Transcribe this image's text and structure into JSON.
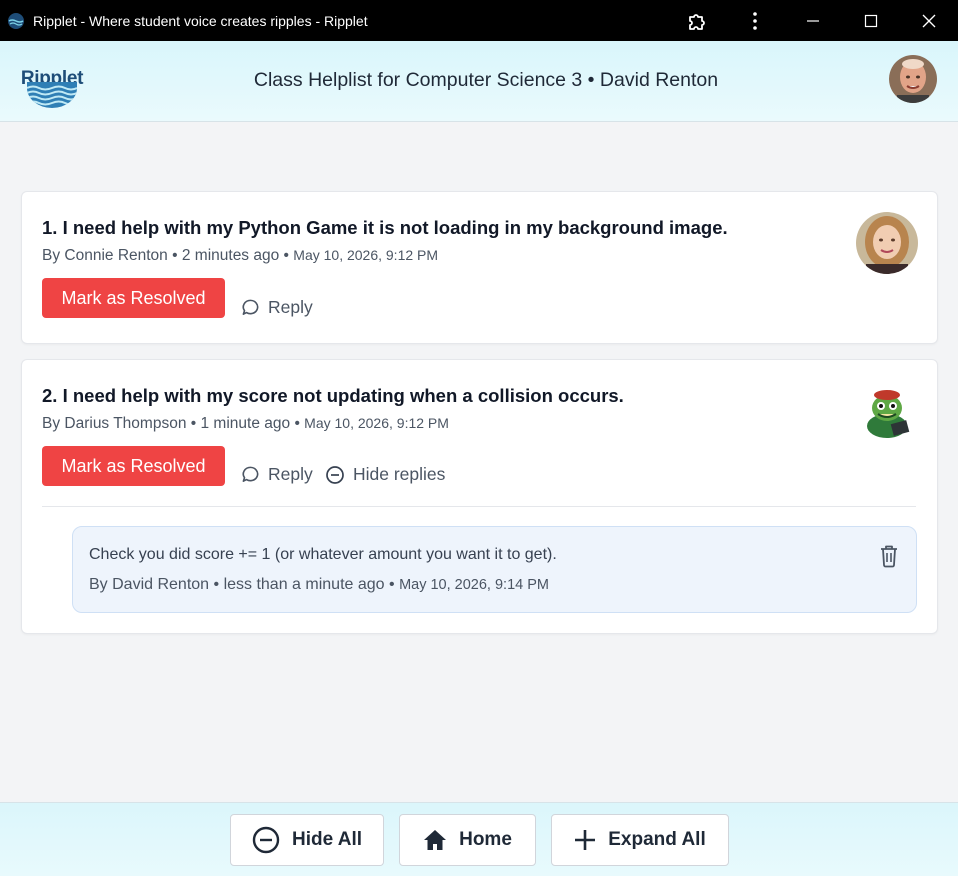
{
  "window": {
    "title": "Ripplet - Where student voice creates ripples - Ripplet",
    "controls": [
      "extensions-icon",
      "more-icon",
      "minimize-icon",
      "maximize-icon",
      "close-icon"
    ]
  },
  "header": {
    "logo_text": "Ripplet",
    "title": "Class Helplist for Computer Science 3 • David Renton"
  },
  "questions": [
    {
      "title": "1. I need help with my Python Game it is not loading in my background image.",
      "author": "By Connie Renton",
      "relative_time": "2 minutes ago",
      "timestamp": "May 10, 2026, 9:12 PM",
      "resolve_label": "Mark as Resolved",
      "reply_label": "Reply"
    },
    {
      "title": "2. I need help with my score not updating when a collision occurs.",
      "author": "By Darius Thompson",
      "relative_time": "1 minute ago",
      "timestamp": "May 10, 2026, 9:12 PM",
      "resolve_label": "Mark as Resolved",
      "reply_label": "Reply",
      "hide_replies_label": "Hide replies",
      "replies": [
        {
          "text": "Check you did score += 1 (or whatever amount you want it to get).",
          "author": "By David Renton",
          "relative_time": "less than a minute ago",
          "timestamp": "May 10, 2026, 9:14 PM"
        }
      ]
    }
  ],
  "footer": {
    "hide_all": "Hide All",
    "home": "Home",
    "expand_all": "Expand All"
  },
  "colors": {
    "resolve": "#ef4444",
    "header_bg": "#d9f6fb",
    "reply_bg": "#eef4fc"
  }
}
